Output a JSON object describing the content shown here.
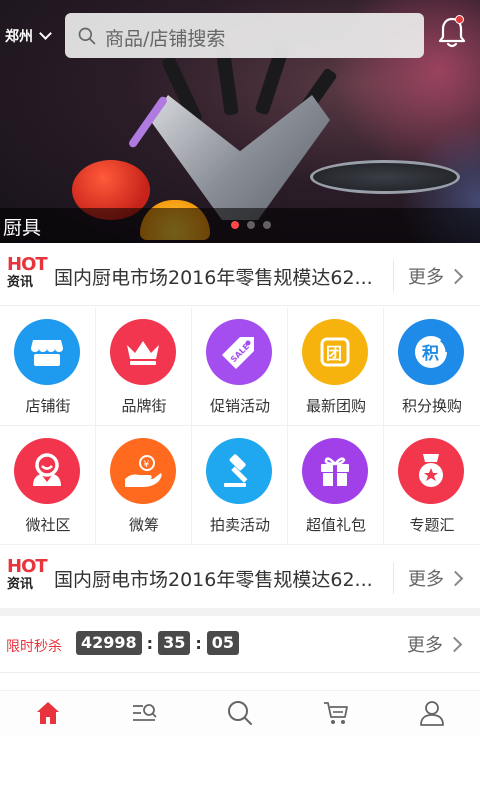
{
  "header": {
    "city": "郑州",
    "search_placeholder": "商品/店铺搜索"
  },
  "banner": {
    "caption": "厨具",
    "slides": 3,
    "active_slide": 1
  },
  "news": [
    {
      "logo_top": "HOT",
      "logo_bottom": "资讯",
      "text": "国内厨电市场2016年零售规模达62...",
      "more": "更多"
    },
    {
      "logo_top": "HOT",
      "logo_bottom": "资讯",
      "text": "国内厨电市场2016年零售规模达62...",
      "more": "更多"
    }
  ],
  "categories": [
    {
      "label": "店铺街",
      "icon": "store-icon",
      "color": "#1e9bef"
    },
    {
      "label": "品牌街",
      "icon": "crown-icon",
      "color": "#f2364f"
    },
    {
      "label": "促销活动",
      "icon": "sale-tag-icon",
      "color": "#a44ef0"
    },
    {
      "label": "最新团购",
      "icon": "group-buy-icon",
      "color": "#f6b20d"
    },
    {
      "label": "积分换购",
      "icon": "points-icon",
      "color": "#1f8be8"
    },
    {
      "label": "微社区",
      "icon": "community-icon",
      "color": "#f3344d"
    },
    {
      "label": "微筹",
      "icon": "crowdfund-icon",
      "color": "#ff6a1f"
    },
    {
      "label": "拍卖活动",
      "icon": "auction-icon",
      "color": "#1fa8ef"
    },
    {
      "label": "超值礼包",
      "icon": "gift-icon",
      "color": "#a140e8"
    },
    {
      "label": "专题汇",
      "icon": "topic-medal-icon",
      "color": "#f2364b"
    }
  ],
  "flash_sale": {
    "label": "限时秒杀",
    "hours": "42998",
    "minutes": "35",
    "seconds": "05",
    "more": "更多"
  },
  "tabbar": {
    "active_color": "#e8343c",
    "items": [
      "home-icon",
      "category-icon",
      "search-icon",
      "cart-icon",
      "user-icon"
    ]
  }
}
